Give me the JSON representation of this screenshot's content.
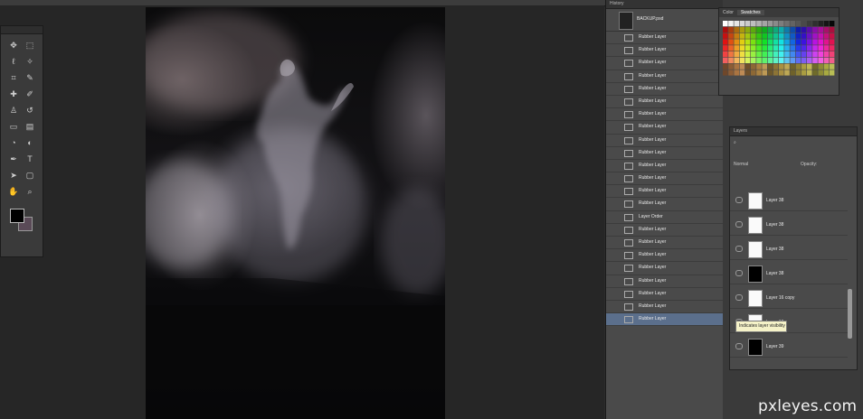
{
  "window": {
    "title": ""
  },
  "tools": {
    "items": [
      {
        "name": "move-tool-icon",
        "glyph": "✥"
      },
      {
        "name": "marquee-tool-icon",
        "glyph": "⬚"
      },
      {
        "name": "lasso-tool-icon",
        "glyph": "ℓ"
      },
      {
        "name": "magic-wand-tool-icon",
        "glyph": "✧"
      },
      {
        "name": "crop-tool-icon",
        "glyph": "⌗"
      },
      {
        "name": "eyedropper-tool-icon",
        "glyph": "✎"
      },
      {
        "name": "healing-brush-tool-icon",
        "glyph": "✚"
      },
      {
        "name": "brush-tool-icon",
        "glyph": "✐"
      },
      {
        "name": "clone-stamp-tool-icon",
        "glyph": "♙"
      },
      {
        "name": "history-brush-tool-icon",
        "glyph": "↺"
      },
      {
        "name": "eraser-tool-icon",
        "glyph": "▭"
      },
      {
        "name": "gradient-tool-icon",
        "glyph": "▤"
      },
      {
        "name": "blur-tool-icon",
        "glyph": "◔"
      },
      {
        "name": "dodge-tool-icon",
        "glyph": "◐"
      },
      {
        "name": "pen-tool-icon",
        "glyph": "✒"
      },
      {
        "name": "type-tool-icon",
        "glyph": "T"
      },
      {
        "name": "path-selection-tool-icon",
        "glyph": "➤"
      },
      {
        "name": "shape-tool-icon",
        "glyph": "▢"
      },
      {
        "name": "hand-tool-icon",
        "glyph": "✋"
      },
      {
        "name": "zoom-tool-icon",
        "glyph": "⌕"
      }
    ],
    "foreground_color": "#000000",
    "background_color": "#5a4a57"
  },
  "history": {
    "tab_label": "History",
    "snapshot_label": "BACKUP.psd",
    "steps": [
      "Rubber Layer",
      "Rubber Layer",
      "Rubber Layer",
      "Rubber Layer",
      "Rubber Layer",
      "Rubber Layer",
      "Rubber Layer",
      "Rubber Layer",
      "Rubber Layer",
      "Rubber Layer",
      "Rubber Layer",
      "Rubber Layer",
      "Rubber Layer",
      "Rubber Layer",
      "Layer Order",
      "Rubber Layer",
      "Rubber Layer",
      "Rubber Layer",
      "Rubber Layer",
      "Rubber Layer",
      "Rubber Layer",
      "Rubber Layer",
      "Rubber Layer"
    ],
    "active_index": 22
  },
  "swatches": {
    "tabs": [
      "Color",
      "Swatches"
    ],
    "active_tab": 1
  },
  "layers": {
    "tab_label": "Layers",
    "blend_mode": "Normal",
    "opacity_label": "Opacity:",
    "rows": [
      {
        "name": "Layer 38",
        "thumb": "light"
      },
      {
        "name": "Layer 38",
        "thumb": "light"
      },
      {
        "name": "Layer 38",
        "thumb": "light"
      },
      {
        "name": "Layer 38",
        "thumb": "dark"
      },
      {
        "name": "Layer 16 copy",
        "thumb": "light"
      },
      {
        "name": "Layer 16",
        "thumb": "light"
      },
      {
        "name": "Layer 39",
        "thumb": "dark"
      }
    ],
    "tooltip": "Indicates layer visibility"
  },
  "watermark": "pxleyes.com"
}
